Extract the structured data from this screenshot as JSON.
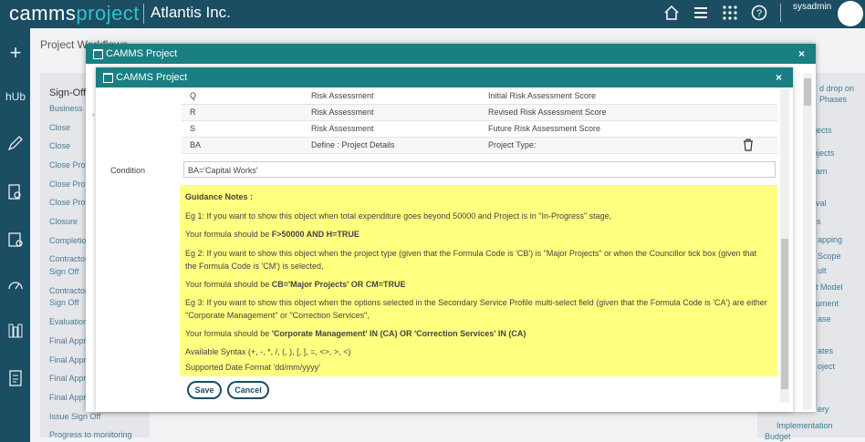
{
  "header": {
    "brand_part1": "camms",
    "brand_part2": "project",
    "org": "Atlantis Inc.",
    "username": "sysadmin"
  },
  "background": {
    "page_title": "Project Workflows",
    "panel_title": "Sign-Off T",
    "left_items": [
      "Business",
      "Close",
      "Close",
      "Close Pro",
      "Close Pro",
      "Close Pro",
      "Closure",
      "Completio",
      "Contractor",
      "Sign Off",
      "Contractor",
      "Sign Off",
      "Evaluation",
      "Final Appr",
      "Final Appr",
      "Final Appr",
      "Final Appr",
      "Issue Sign Off",
      "Progress to monitoring"
    ],
    "right_items": [
      "d drop on",
      "Phases",
      "jects",
      "rojects",
      "am",
      "val",
      "s",
      "apping",
      "Scope",
      "ult",
      "t Model",
      "ument",
      "ase",
      "ates",
      "oject",
      "ery",
      "Implementation",
      "Budget"
    ]
  },
  "outer_modal": {
    "title": "CAMMS Project",
    "close": "×"
  },
  "inner_modal": {
    "title": "CAMMS Project",
    "close": "×"
  },
  "table": {
    "rows": [
      {
        "code": "Q",
        "category": "Risk Assessment",
        "field": "Initial Risk Assessment Score"
      },
      {
        "code": "R",
        "category": "Risk Assessment",
        "field": "Revised Risk Assessment Score"
      },
      {
        "code": "S",
        "category": "Risk Assessment",
        "field": "Future Risk Assessment Score"
      },
      {
        "code": "BA",
        "category": "Define : Project Details",
        "field": "Project Type:"
      }
    ]
  },
  "condition": {
    "label": "Condition",
    "value": "BA='Capital Works'"
  },
  "guidance": {
    "title": "Guidance Notes :",
    "eg1": "Eg 1: If you want to show this object when total expenditure goes beyond 50000 and Project is in \"In-Progress\" stage,",
    "formula1_prefix": "Your formula should be ",
    "formula1": "F>50000 AND H=TRUE",
    "eg2_line1": "Eg 2: If you want to show this object when the project type (given that the Formula Code is 'CB') is \"Major Projects\" or when the Councillor tick box (given that",
    "eg2_line2": "the Formula Code is 'CM') is selected,",
    "formula2_prefix": "Your formula should be ",
    "formula2": "CB='Major Projects' OR CM=TRUE",
    "eg3_line1": "Eg 3: If you want to show this object when the options selected in the Secondary Service Profile multi-select field (given that the Formula Code is 'CA') are either",
    "eg3_line2": "\"Corporate Management\" or \"Correction Services\",",
    "formula3_prefix": "Your formula should be ",
    "formula3": "'Corporate Management' IN (CA) OR 'Correction Services' IN (CA)",
    "syntax": "Available Syntax (+, -, *, /, (, ), [, ], =, <>, >, <)",
    "date_format": "Supported Date Format 'dd/mm/yyyy'"
  },
  "buttons": {
    "save": "Save",
    "cancel": "Cancel"
  }
}
